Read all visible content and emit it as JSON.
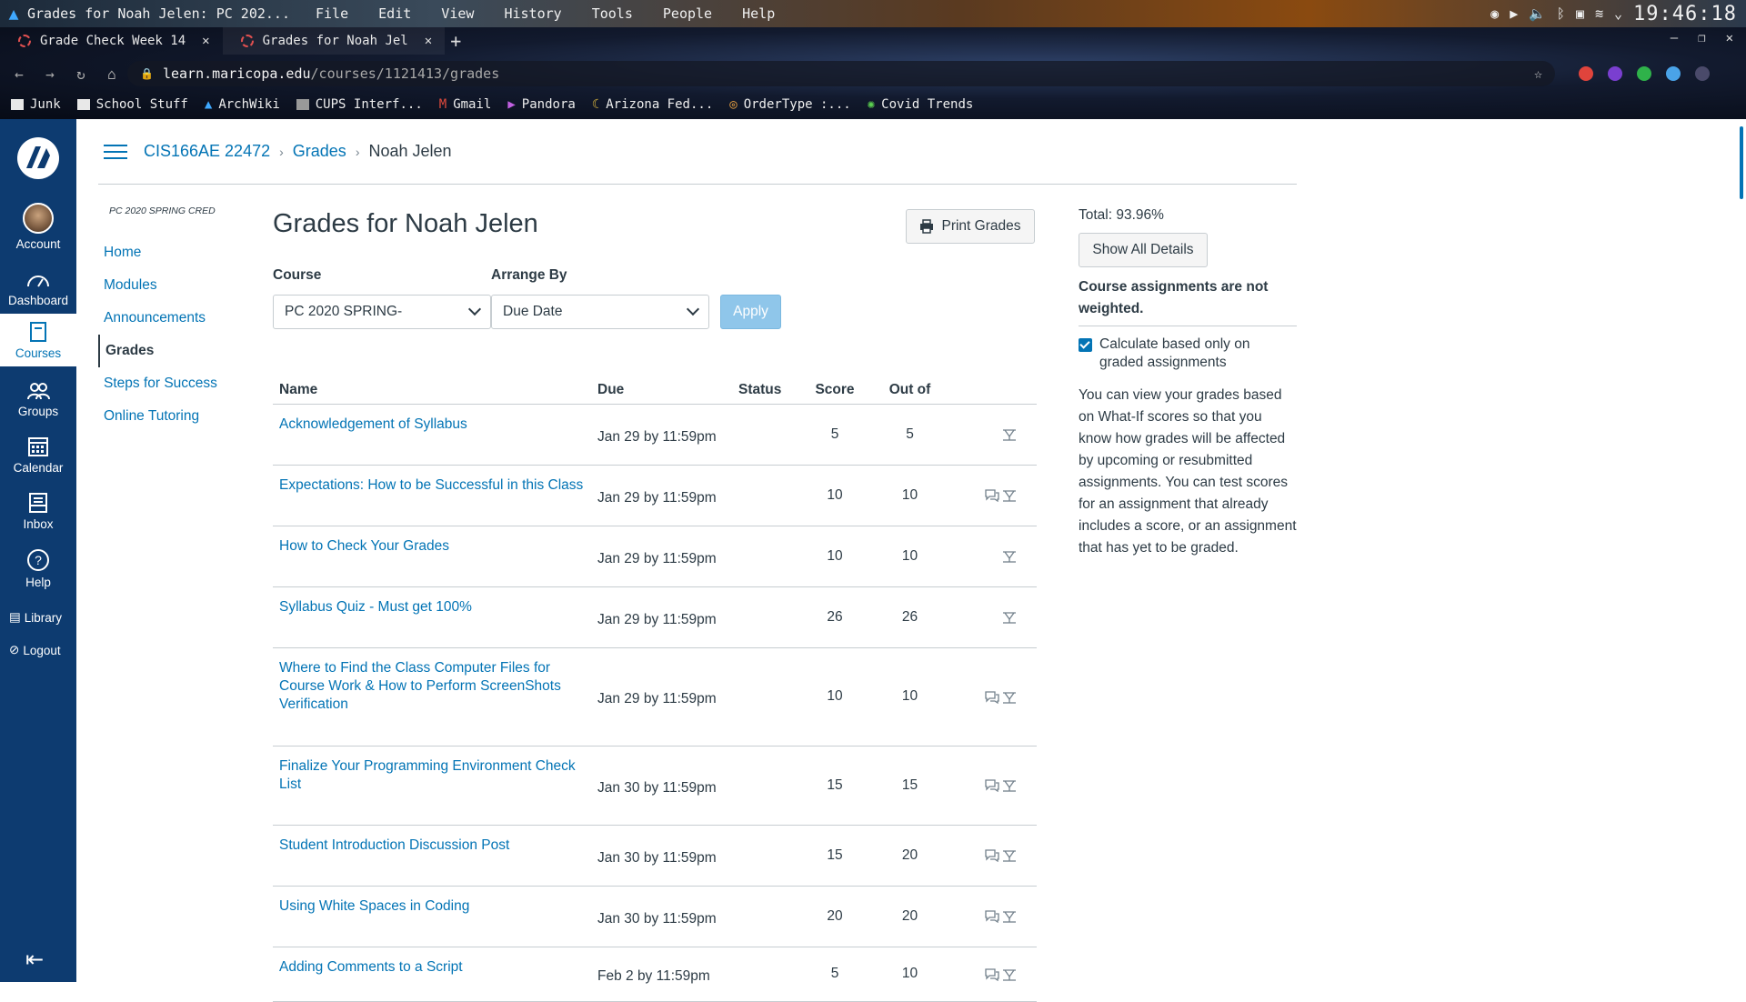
{
  "os": {
    "window_title": "Grades for Noah Jelen: PC 202...",
    "menu": [
      "File",
      "Edit",
      "View",
      "History",
      "Tools",
      "People",
      "Help"
    ],
    "clock": "19:46:18"
  },
  "browser": {
    "tabs": [
      {
        "label": "Grade Check Week 14"
      },
      {
        "label": "Grades for Noah Jel"
      }
    ],
    "url_host": "learn.maricopa.edu",
    "url_path": "/courses/1121413/grades",
    "bookmarks": [
      {
        "label": "Junk",
        "icon": "folder-icon"
      },
      {
        "label": "School Stuff",
        "icon": "folder-icon"
      },
      {
        "label": "ArchWiki",
        "icon": "arch-icon"
      },
      {
        "label": "CUPS Interf...",
        "icon": "printer-icon"
      },
      {
        "label": "Gmail",
        "icon": "gmail-icon"
      },
      {
        "label": "Pandora",
        "icon": "pandora-icon"
      },
      {
        "label": "Arizona Fed...",
        "icon": "moon-icon"
      },
      {
        "label": "OrderType :...",
        "icon": "ordertype-icon"
      },
      {
        "label": "Covid Trends",
        "icon": "virus-icon"
      }
    ]
  },
  "globalnav": {
    "account": "Account",
    "dashboard": "Dashboard",
    "courses": "Courses",
    "groups": "Groups",
    "calendar": "Calendar",
    "inbox": "Inbox",
    "help": "Help",
    "library": "Library",
    "logout": "Logout"
  },
  "breadcrumb": {
    "course": "CIS166AE 22472",
    "section": "Grades",
    "current": "Noah Jelen"
  },
  "coursenav": {
    "term": "PC 2020 SPRING CRED",
    "links": [
      "Home",
      "Modules",
      "Announcements",
      "Grades",
      "Steps for Success",
      "Online Tutoring"
    ]
  },
  "main": {
    "title": "Grades for Noah Jelen",
    "print_label": "Print Grades",
    "course_label": "Course",
    "course_value": "PC 2020 SPRING-",
    "arrange_label": "Arrange By",
    "arrange_value": "Due Date",
    "apply_label": "Apply",
    "columns": [
      "Name",
      "Due",
      "Status",
      "Score",
      "Out of"
    ]
  },
  "rows": [
    {
      "name": "Acknowledgement of Syllabus",
      "due": "Jan 29 by 11:59pm",
      "score": "5",
      "out_of": "5",
      "comments": false
    },
    {
      "name": "Expectations: How to be Successful in this Class",
      "due": "Jan 29 by 11:59pm",
      "score": "10",
      "out_of": "10",
      "comments": true
    },
    {
      "name": "How to Check Your Grades",
      "due": "Jan 29 by 11:59pm",
      "score": "10",
      "out_of": "10",
      "comments": false
    },
    {
      "name": "Syllabus Quiz - Must get 100%",
      "due": "Jan 29 by 11:59pm",
      "score": "26",
      "out_of": "26",
      "comments": false
    },
    {
      "name": "Where to Find the Class Computer Files for Course Work & How to Perform ScreenShots Verification",
      "due": "Jan 29 by 11:59pm",
      "score": "10",
      "out_of": "10",
      "comments": true
    },
    {
      "name": "Finalize Your Programming Environment Check List",
      "due": "Jan 30 by 11:59pm",
      "score": "15",
      "out_of": "15",
      "comments": true
    },
    {
      "name": "Student Introduction Discussion Post",
      "due": "Jan 30 by 11:59pm",
      "score": "15",
      "out_of": "20",
      "comments": true
    },
    {
      "name": "Using White Spaces in Coding",
      "due": "Jan 30 by 11:59pm",
      "score": "20",
      "out_of": "20",
      "comments": true
    },
    {
      "name": "Adding Comments to a Script",
      "due": "Feb 2 by 11:59pm",
      "score": "5",
      "out_of": "10",
      "comments": true
    }
  ],
  "sidebar": {
    "total": "Total: 93.96%",
    "show_all": "Show All Details",
    "weighted": "Course assignments are not weighted.",
    "calc_label": "Calculate based only on graded assignments",
    "whatif": "You can view your grades based on What-If scores so that you know how grades will be affected by upcoming or resubmitted assignments. You can test scores for an assignment that already includes a score, or an assignment that has yet to be graded."
  }
}
